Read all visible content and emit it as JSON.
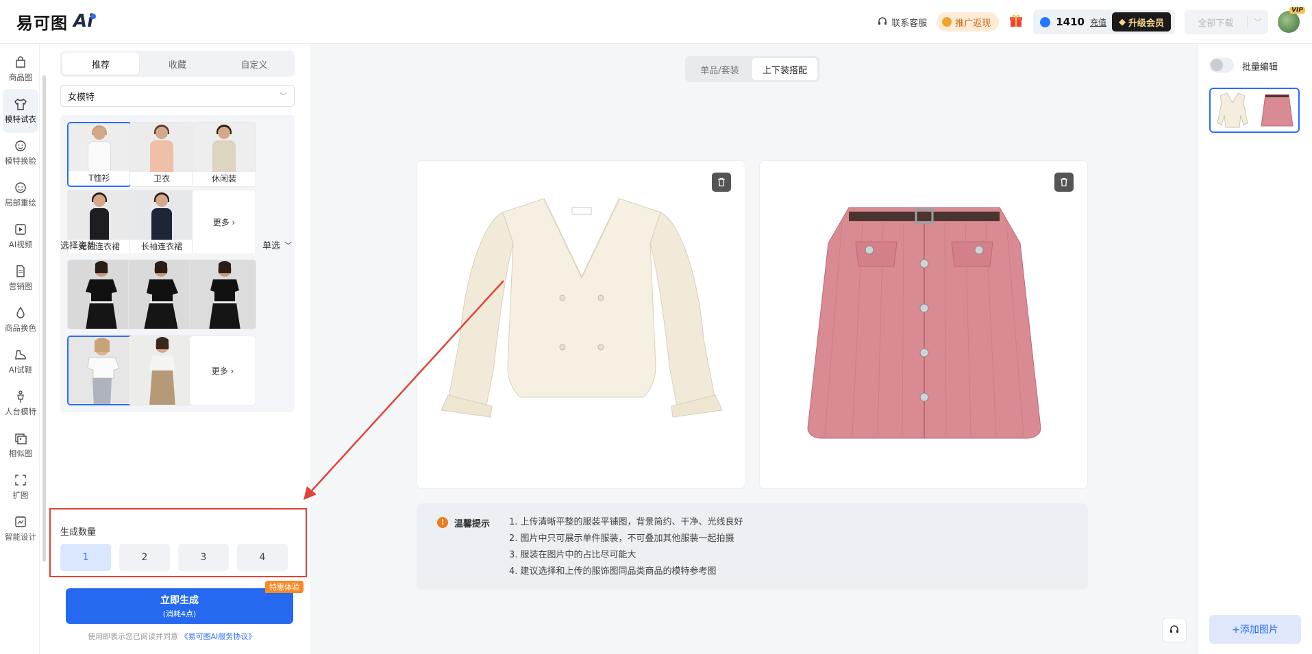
{
  "header": {
    "logo_text": "易可图",
    "logo_ai": "Ai",
    "contact": "联系客服",
    "promo": "推广返现",
    "points": "1410",
    "recharge": "充值",
    "upgrade": "升级会员",
    "download_all": "全部下载",
    "vip_badge": "VIP"
  },
  "nav": [
    {
      "label": "商品图",
      "icon": "bag-icon"
    },
    {
      "label": "模特试衣",
      "icon": "shirt-icon",
      "active": true
    },
    {
      "label": "模特换脸",
      "icon": "face-icon"
    },
    {
      "label": "局部重绘",
      "icon": "face-icon"
    },
    {
      "label": "AI视频",
      "icon": "video-icon"
    },
    {
      "label": "营销图",
      "icon": "document-icon"
    },
    {
      "label": "商品换色",
      "icon": "drop-icon"
    },
    {
      "label": "AI试鞋",
      "icon": "shoe-icon"
    },
    {
      "label": "人台模特",
      "icon": "mannequin-icon"
    },
    {
      "label": "相似图",
      "icon": "images-icon"
    },
    {
      "label": "扩图",
      "icon": "expand-icon"
    },
    {
      "label": "智能设计",
      "icon": "design-icon"
    }
  ],
  "panel": {
    "tabs": [
      "推荐",
      "收藏",
      "自定义"
    ],
    "model_type": "女模特",
    "models": [
      {
        "label": "T恤衫",
        "selected": true
      },
      {
        "label": "卫衣"
      },
      {
        "label": "休闲装"
      },
      {
        "label": "无袖连衣裙"
      },
      {
        "label": "长袖连衣裙"
      }
    ],
    "more": "更多 ›",
    "pose_title": "选择姿势",
    "pose_mode": "单选",
    "pose_more": "更多 ›",
    "count_title": "生成数量",
    "counts": [
      "1",
      "2",
      "3",
      "4"
    ],
    "generate": "立即生成",
    "generate_cost": "(消耗4点)",
    "badge": "特惠体验",
    "agree_prefix": "使用即表示您已阅读并同意",
    "agree_link": "《易可图AI服务协议》"
  },
  "canvas": {
    "modes": [
      "单品/套装",
      "上下装搭配"
    ],
    "tips_title": "温馨提示",
    "tips": [
      "1. 上传清晰平整的服装平铺图，背景简约、干净、光线良好",
      "2. 图片中只可展示单件服装，不可叠加其他服装一起拍摄",
      "3. 服装在图片中的占比尽可能大",
      "4. 建议选择和上传的服饰图同品类商品的模特参考图"
    ]
  },
  "right": {
    "batch_edit": "批量编辑",
    "add_image": "+添加图片"
  },
  "colors": {
    "primary": "#2469f0",
    "highlight": "#e04338",
    "badge": "#f78a27"
  }
}
